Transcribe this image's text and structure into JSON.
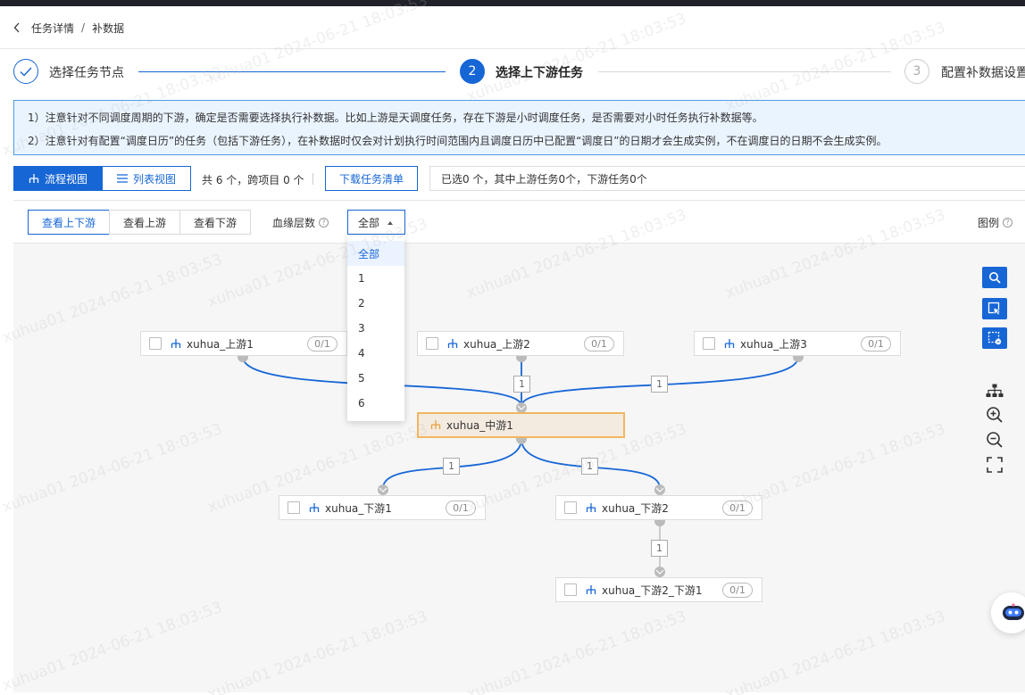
{
  "breadcrumb": {
    "parent": "任务详情",
    "separator": "/",
    "current": "补数据"
  },
  "steps": [
    {
      "label": "选择任务节点",
      "number": "",
      "state": "done"
    },
    {
      "label": "选择上下游任务",
      "number": "2",
      "state": "active"
    },
    {
      "label": "配置补数据设置",
      "number": "3",
      "state": "todo"
    }
  ],
  "notice": {
    "line1": "1）注意针对不同调度周期的下游，确定是否需要选择执行补数据。比如上游是天调度任务，存在下游是小时调度任务，是否需要对小时任务执行补数据等。",
    "line2": "2）注意针对有配置“调度日历”的任务（包括下游任务），在补数据时仅会对计划执行时间范围内且调度日历中已配置“调度日”的日期才会生成实例，不在调度日的日期不会生成实例。"
  },
  "toolbar": {
    "flow_view": "流程视图",
    "list_view": "列表视图",
    "count_text": "共 6 个，跨项目 0 个",
    "download": "下载任务清单",
    "selected_text": "已选0 个，其中上游任务0个，下游任务0个"
  },
  "panel": {
    "seg_both": "查看上下游",
    "seg_up": "查看上游",
    "seg_down": "查看下游",
    "depth_label": "血缘层数",
    "depth_value": "全部",
    "legend": "图例",
    "help_glyph": "?"
  },
  "dropdown_options": [
    "全部",
    "1",
    "2",
    "3",
    "4",
    "5",
    "6"
  ],
  "nodes": {
    "up1": {
      "name": "xuhua_上游1",
      "ratio": "0/1"
    },
    "up2": {
      "name": "xuhua_上游2",
      "ratio": "0/1"
    },
    "up3": {
      "name": "xuhua_上游3",
      "ratio": "0/1"
    },
    "mid1": {
      "name": "xuhua_中游1"
    },
    "down1": {
      "name": "xuhua_下游1",
      "ratio": "0/1"
    },
    "down2": {
      "name": "xuhua_下游2",
      "ratio": "0/1"
    },
    "down2_1": {
      "name": "xuhua_下游2_下游1",
      "ratio": "0/1"
    }
  },
  "edge_labels": {
    "up2_mid": "1",
    "up3_mid": "1",
    "mid_down1": "1",
    "mid_down2": "1",
    "down2_down21": "1"
  },
  "watermark": "xuhua01 2024-06-21 18:03:53",
  "colors": {
    "primary": "#1766d6",
    "center_node_border": "#f0b660",
    "center_node_bg": "#f4ebe0"
  },
  "icons": [
    "chevron-left-icon",
    "check-icon",
    "flow-tree-icon",
    "list-icon",
    "help-icon",
    "search-icon",
    "select-cursor-icon",
    "box-select-icon",
    "layout-tree-icon",
    "zoom-in-icon",
    "zoom-out-icon",
    "fullscreen-icon",
    "assistant-bot-icon"
  ]
}
